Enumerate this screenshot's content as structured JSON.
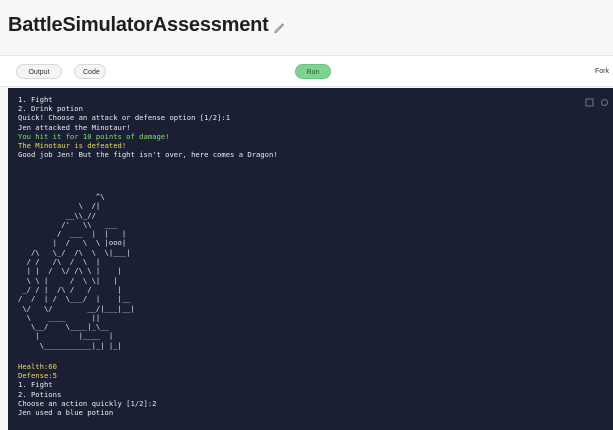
{
  "header": {
    "title": "BattleSimulatorAssessment"
  },
  "toolbar": {
    "output_label": "Output",
    "code_label": "Code",
    "run_label": "Run",
    "right_label": "Fork"
  },
  "console": {
    "lines": [
      {
        "text": "1. Fight",
        "color": "default"
      },
      {
        "text": "2. Drink potion",
        "color": "default"
      },
      {
        "text": "Quick! Choose an attack or defense option [1/2]:1",
        "color": "default"
      },
      {
        "text": "Jen attacked the Minotaur!",
        "color": "default"
      },
      {
        "text": "You hit it for 10 points of damage!",
        "color": "green"
      },
      {
        "text": "The Minotaur is defeated!",
        "color": "yellow"
      },
      {
        "text": "Good job Jen! But the fight isn't over, here comes a Dragon!",
        "color": "default"
      }
    ],
    "art_lines": [
      "                  ^\\",
      "              \\  /|",
      "           __\\\\_//",
      "          /'   \\\\   ___",
      "         /  ___  |  |   |",
      "        |  /   \\  \\ |ooo|",
      "   /\\   \\_/  /\\  \\  \\|___|",
      "  / /   /\\  /  \\  |",
      "  | |  /  \\/ /\\ \\ |    |",
      "  \\ \\ |     /  \\ \\|   |",
      " _/ / |  /\\ /   /      |",
      "/  /  | /  \\___/  |    |__",
      " \\/   \\/        __/|___|__|",
      "  \\    ____      ||",
      "   \\__/    \\____|_\\__",
      "    |         |____  |",
      "     \\___________|_| |_|"
    ],
    "lines_after": [
      {
        "text": "Health:60",
        "color": "yellow"
      },
      {
        "text": "Defense:5",
        "color": "yellow"
      },
      {
        "text": "1. Fight",
        "color": "default"
      },
      {
        "text": "2. Potions",
        "color": "default"
      },
      {
        "text": "Choose an action quickly [1/2]:2",
        "color": "default"
      },
      {
        "text": "Jen used a blue potion",
        "color": "default"
      }
    ]
  },
  "colors": {
    "console_bg": "#1b1f33",
    "green": "#7fe06a",
    "yellow": "#e6dc57",
    "run_button": "#7ed391"
  }
}
